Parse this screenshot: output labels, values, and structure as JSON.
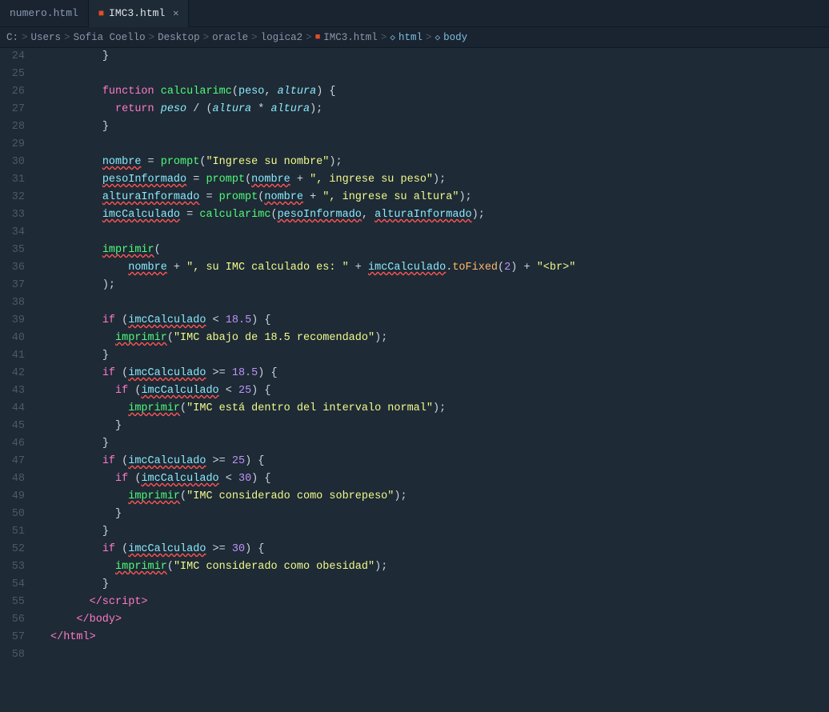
{
  "tabs": [
    {
      "id": "numero",
      "label": "numero.html",
      "active": false,
      "icon": ""
    },
    {
      "id": "imc3",
      "label": "IMC3.html",
      "active": true,
      "icon": "html",
      "closeable": true
    }
  ],
  "breadcrumb": {
    "path": [
      "C:",
      "Users",
      "Sofia Coello",
      "Desktop",
      "oracle",
      "logica2"
    ],
    "file": "IMC3.html",
    "html_node": "html",
    "body_node": "body"
  },
  "editor": {
    "language": "html"
  }
}
